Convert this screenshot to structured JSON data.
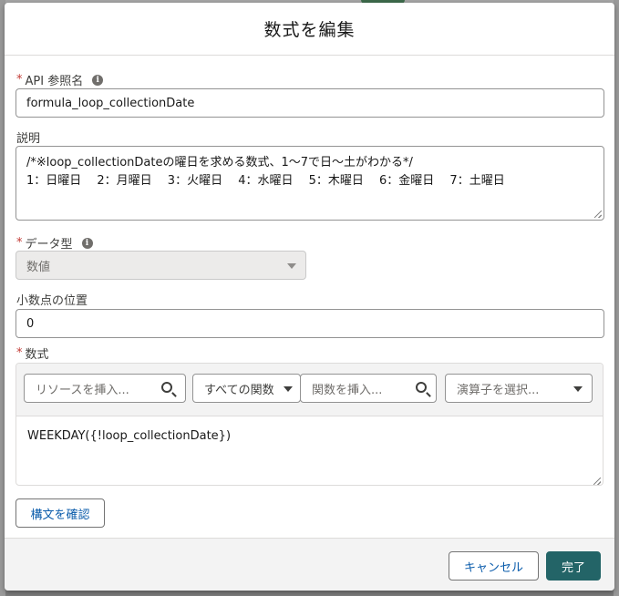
{
  "modal": {
    "title": "数式を編集"
  },
  "fields": {
    "api_name": {
      "required_mark": "*",
      "label": "API 参照名",
      "value": "formula_loop_collectionDate"
    },
    "description": {
      "label": "説明",
      "line1": "/*※loop_collectionDateの曜日を求める数式、1〜7で日〜土がわかる*/",
      "line2": "1：日曜日　 2：月曜日　 3：火曜日　 4：水曜日　 5：木曜日　 6：金曜日　 7：土曜日"
    },
    "data_type": {
      "required_mark": "*",
      "label": "データ型",
      "value": "数値"
    },
    "decimal_places": {
      "label": "小数点の位置",
      "value": "0"
    },
    "formula": {
      "required_mark": "*",
      "label": "数式",
      "resource_placeholder": "リソースを挿入...",
      "function_category": "すべての関数",
      "function_placeholder": "関数を挿入...",
      "operator_placeholder": "演算子を選択...",
      "value": "WEEKDAY({!loop_collectionDate})"
    }
  },
  "buttons": {
    "check_syntax": "構文を確認",
    "cancel": "キャンセル",
    "done": "完了"
  },
  "colors": {
    "brand": "#236467",
    "required": "#c23934",
    "link": "#0b5cab"
  }
}
